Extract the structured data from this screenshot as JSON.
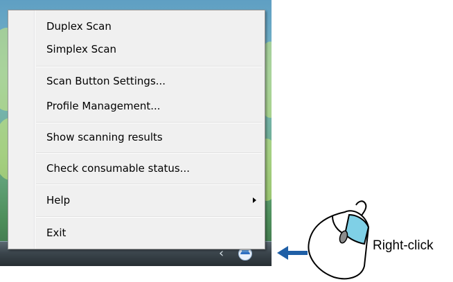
{
  "menu": {
    "items": [
      {
        "label": "Duplex Scan"
      },
      {
        "label": "Simplex Scan"
      },
      {
        "label": "Scan Button Settings..."
      },
      {
        "label": "Profile Management..."
      },
      {
        "label": "Show scanning results"
      },
      {
        "label": "Check consumable status..."
      },
      {
        "label": "Help",
        "has_submenu": true
      },
      {
        "label": "Exit"
      }
    ]
  },
  "taskbar": {
    "tray_icons": [
      "show-hidden-icons-chevron-icon",
      "scanner-tray-icon"
    ]
  },
  "annotation": {
    "label": "Right-click",
    "pointer": "arrow-left-icon",
    "illustration": "mouse-icon"
  },
  "colors": {
    "menu_background": "#f0f0f0",
    "menu_border": "#979797",
    "arrow": "#1f5fa6",
    "mouse_button_highlight": "#7fd0e6",
    "taskbar": "#2f383e"
  }
}
